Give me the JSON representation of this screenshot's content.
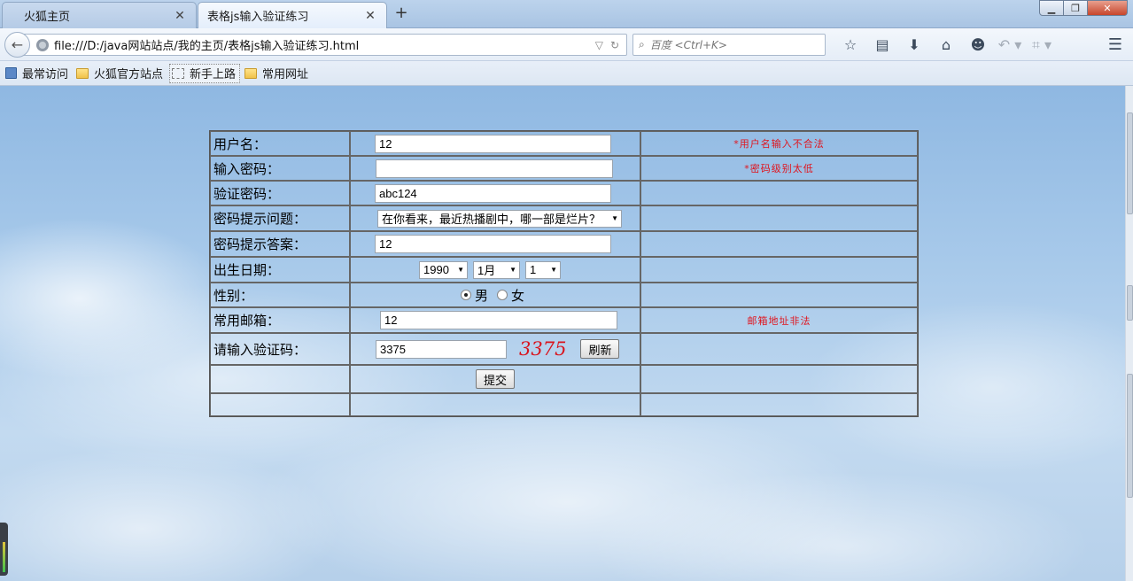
{
  "browser": {
    "tabs": [
      {
        "title": "火狐主页",
        "active": false
      },
      {
        "title": "表格js输入验证练习",
        "active": true
      }
    ],
    "tab_close_glyph": "✕",
    "new_tab_glyph": "+",
    "window_controls": {
      "minimize": "▁",
      "maximize": "❐",
      "close": "✕"
    },
    "url": "file:///D:/java网站站点/我的主页/表格js输入验证练习.html",
    "search_placeholder": "百度 <Ctrl+K>",
    "bookmarks": [
      "最常访问",
      "火狐官方站点",
      "新手上路",
      "常用网址"
    ],
    "icons": {
      "back": "back-arrow-icon",
      "search": "search-icon",
      "bookmark_star": "star-icon",
      "reading_list": "clipboard-icon",
      "download": "download-icon",
      "home": "home-icon",
      "smiley": "smiley-icon",
      "undo": "undo-icon",
      "crop": "crop-icon",
      "menu": "hamburger-icon"
    }
  },
  "form": {
    "rows": [
      {
        "label": "用户名：",
        "value": "12",
        "message": "*用户名输入不合法"
      },
      {
        "label": "输入密码：",
        "value": "",
        "message": "*密码级别太低"
      },
      {
        "label": "验证密码：",
        "value": "abc124",
        "message": ""
      },
      {
        "label": "密码提示问题：",
        "value": "在你看来，最近热播剧中，哪一部是烂片？",
        "message": ""
      },
      {
        "label": "密码提示答案：",
        "value": "12",
        "message": ""
      },
      {
        "label": "出生日期：",
        "year": "1990",
        "month": "1月",
        "day": "1",
        "message": ""
      },
      {
        "label": "性别：",
        "option_male": "男",
        "option_female": "女",
        "selected": "男",
        "message": ""
      },
      {
        "label": "常用邮箱：",
        "value": "12",
        "message": "邮箱地址非法"
      },
      {
        "label": "请输入验证码：",
        "value": "3375",
        "captcha": "3375",
        "refresh_label": "刷新",
        "message": ""
      }
    ],
    "submit_label": "提交"
  },
  "colors": {
    "error_text": "#e0141d",
    "captcha_text": "#d9141d"
  }
}
